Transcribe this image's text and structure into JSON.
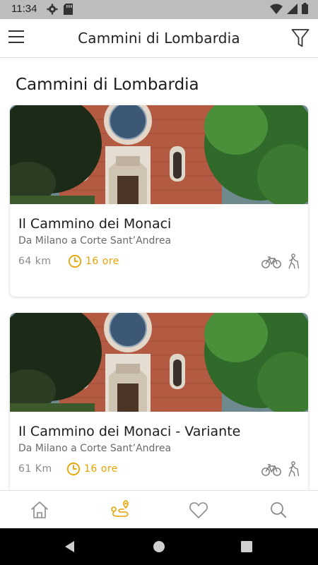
{
  "status_bar": {
    "time": "11:34",
    "icons": [
      "gear-icon",
      "sd-card-icon",
      "wifi-icon",
      "signal-icon",
      "battery-icon"
    ]
  },
  "app_bar": {
    "title": "Cammini di Lombardia",
    "left_icon": "hamburger-menu-icon",
    "right_icon": "filter-funnel-icon"
  },
  "page": {
    "heading": "Cammini di Lombardia"
  },
  "routes": [
    {
      "title": "Il Cammino dei Monaci",
      "subtitle": "Da Milano a Corte Sant’Andrea",
      "distance": "64 km",
      "duration": "16 ore",
      "modes": [
        "bicycle-icon",
        "hiking-icon"
      ]
    },
    {
      "title": "Il Cammino dei Monaci - Variante",
      "subtitle": "Da Milano a Corte Sant’Andrea",
      "distance": "61 Km",
      "duration": "16 ore",
      "modes": [
        "bicycle-icon",
        "hiking-icon"
      ]
    }
  ],
  "bottom_nav": {
    "items": [
      "home-icon",
      "route-map-icon",
      "heart-icon",
      "search-icon"
    ],
    "active": "route-map-icon"
  },
  "colors": {
    "accent": "#e8a200",
    "status_bar": "#bdbdbd",
    "text_primary": "#1c1c1c",
    "text_secondary": "#6a6a6a",
    "system_nav": "#000000"
  }
}
